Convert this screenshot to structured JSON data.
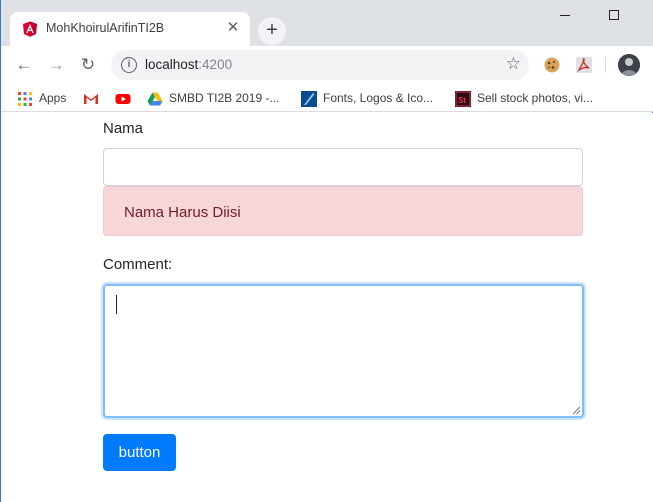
{
  "browser": {
    "tab": {
      "title": "MohKhoirulArifinTI2B",
      "close": "✕"
    },
    "new_tab": "+",
    "address": {
      "host": "localhost",
      "port": ":4200"
    },
    "bookmarks": [
      {
        "label": "Apps",
        "icon": "apps-grid-icon"
      },
      {
        "label": "",
        "icon": "gmail-icon"
      },
      {
        "label": "",
        "icon": "youtube-icon"
      },
      {
        "label": "SMBD TI2B 2019 -...",
        "icon": "google-drive-icon"
      },
      {
        "label": "Fonts, Logos & Ico...",
        "icon": "bookmark-site-icon"
      },
      {
        "label": "Sell stock photos, vi...",
        "icon": "adobe-stock-icon"
      }
    ],
    "colors": {
      "tab_strip": "#dee1e6",
      "accent": "#1a73e8"
    }
  },
  "form": {
    "name_label": "Nama",
    "name_value": "",
    "name_error": "Nama Harus Diisi",
    "comment_label": "Comment:",
    "comment_value": "",
    "submit_label": "button",
    "colors": {
      "primary": "#007bff",
      "error_bg": "#f8d7da",
      "error_text": "#721c24",
      "focus": "#80bdff"
    }
  }
}
